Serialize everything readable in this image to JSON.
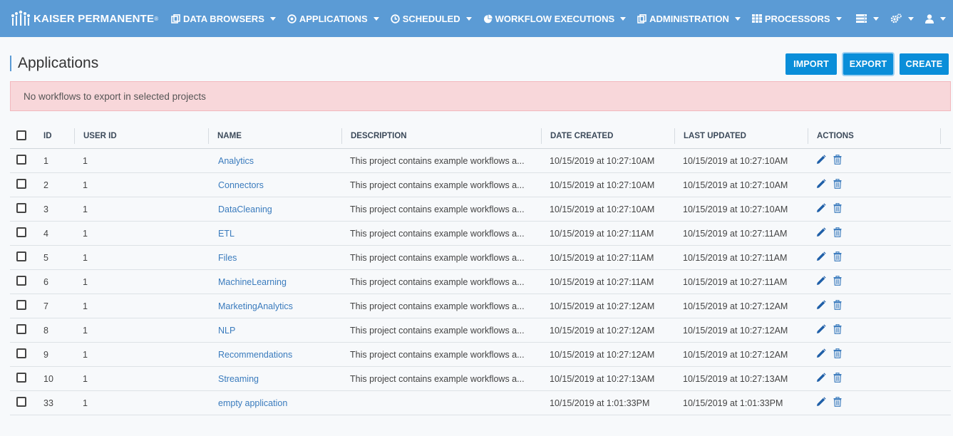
{
  "brand": {
    "name": "KAISER PERMANENTE",
    "reg": "®"
  },
  "nav": [
    {
      "label": "DATA BROWSERS",
      "icon": "copy-icon"
    },
    {
      "label": "APPLICATIONS",
      "icon": "app-circle-icon"
    },
    {
      "label": "SCHEDULED",
      "icon": "clock-icon"
    },
    {
      "label": "WORKFLOW EXECUTIONS",
      "icon": "pie-chart-icon"
    },
    {
      "label": "ADMINISTRATION",
      "icon": "copy-icon"
    },
    {
      "label": "PROCESSORS",
      "icon": "grid-icon"
    }
  ],
  "nav_right": [
    {
      "icon": "server-icon"
    },
    {
      "icon": "gears-icon"
    },
    {
      "icon": "user-icon"
    }
  ],
  "page": {
    "title": "Applications",
    "buttons": {
      "import": "IMPORT",
      "export": "EXPORT",
      "create": "CREATE"
    },
    "alert": "No workflows to export in selected projects"
  },
  "table": {
    "headers": {
      "id": "ID",
      "user_id": "USER ID",
      "name": "NAME",
      "description": "DESCRIPTION",
      "date_created": "DATE CREATED",
      "last_updated": "LAST UPDATED",
      "actions": "ACTIONS"
    },
    "rows": [
      {
        "id": "1",
        "user_id": "1",
        "name": "Analytics",
        "description": "This project contains example workflows a...",
        "date_created": "10/15/2019 at 10:27:10AM",
        "last_updated": "10/15/2019 at 10:27:10AM"
      },
      {
        "id": "2",
        "user_id": "1",
        "name": "Connectors",
        "description": "This project contains example workflows a...",
        "date_created": "10/15/2019 at 10:27:10AM",
        "last_updated": "10/15/2019 at 10:27:10AM"
      },
      {
        "id": "3",
        "user_id": "1",
        "name": "DataCleaning",
        "description": "This project contains example workflows a...",
        "date_created": "10/15/2019 at 10:27:10AM",
        "last_updated": "10/15/2019 at 10:27:10AM"
      },
      {
        "id": "4",
        "user_id": "1",
        "name": "ETL",
        "description": "This project contains example workflows a...",
        "date_created": "10/15/2019 at 10:27:11AM",
        "last_updated": "10/15/2019 at 10:27:11AM"
      },
      {
        "id": "5",
        "user_id": "1",
        "name": "Files",
        "description": "This project contains example workflows a...",
        "date_created": "10/15/2019 at 10:27:11AM",
        "last_updated": "10/15/2019 at 10:27:11AM"
      },
      {
        "id": "6",
        "user_id": "1",
        "name": "MachineLearning",
        "description": "This project contains example workflows a...",
        "date_created": "10/15/2019 at 10:27:11AM",
        "last_updated": "10/15/2019 at 10:27:11AM"
      },
      {
        "id": "7",
        "user_id": "1",
        "name": "MarketingAnalytics",
        "description": "This project contains example workflows a...",
        "date_created": "10/15/2019 at 10:27:12AM",
        "last_updated": "10/15/2019 at 10:27:12AM"
      },
      {
        "id": "8",
        "user_id": "1",
        "name": "NLP",
        "description": "This project contains example workflows a...",
        "date_created": "10/15/2019 at 10:27:12AM",
        "last_updated": "10/15/2019 at 10:27:12AM"
      },
      {
        "id": "9",
        "user_id": "1",
        "name": "Recommendations",
        "description": "This project contains example workflows a...",
        "date_created": "10/15/2019 at 10:27:12AM",
        "last_updated": "10/15/2019 at 10:27:12AM"
      },
      {
        "id": "10",
        "user_id": "1",
        "name": "Streaming",
        "description": "This project contains example workflows a...",
        "date_created": "10/15/2019 at 10:27:13AM",
        "last_updated": "10/15/2019 at 10:27:13AM"
      },
      {
        "id": "33",
        "user_id": "1",
        "name": "empty application",
        "description": "",
        "date_created": "10/15/2019 at 1:01:33PM",
        "last_updated": "10/15/2019 at 1:01:33PM"
      }
    ]
  },
  "colors": {
    "navbar": "#5b9bd5",
    "primary_button": "#0a8ed9",
    "alert_bg": "#f8d7da",
    "link": "#3a7bbd",
    "edit_icon": "#1f5fa8",
    "delete_icon": "#3a7bbd"
  }
}
